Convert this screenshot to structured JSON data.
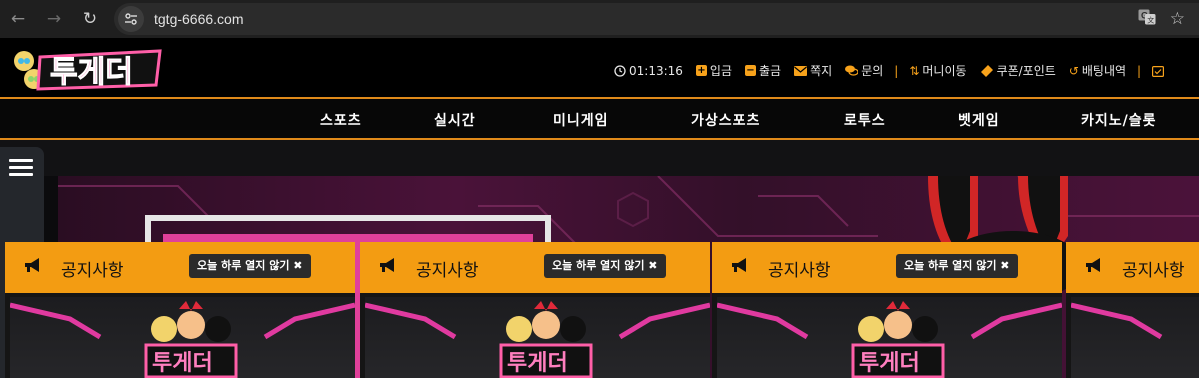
{
  "browser": {
    "url": "tgtg-6666.com",
    "icons": [
      "back-icon",
      "forward-icon",
      "reload-icon",
      "site-settings-icon",
      "translate-icon",
      "bookmark-star-icon"
    ]
  },
  "site": {
    "logo_text": "투게더",
    "clock": "01:13:16",
    "top_links": [
      "입금",
      "출금",
      "쪽지",
      "문의",
      "머니이동",
      "쿠폰/포인트",
      "배팅내역"
    ],
    "accent": "#f39c12",
    "nav": [
      "스포츠",
      "실시간",
      "미니게임",
      "가상스포츠",
      "로투스",
      "벳게임",
      "카지노/슬롯"
    ]
  },
  "popups": [
    {
      "title": "공지사항",
      "dismiss": "오늘 하루 열지 않기 ✖",
      "brand": "투게더"
    },
    {
      "title": "공지사항",
      "dismiss": "오늘 하루 열지 않기 ✖",
      "brand": "투게더"
    },
    {
      "title": "공지사항",
      "dismiss": "오늘 하루 열지 않기 ✖",
      "brand": "투게더"
    },
    {
      "title": "공지사항",
      "dismiss": "",
      "brand": ""
    }
  ]
}
